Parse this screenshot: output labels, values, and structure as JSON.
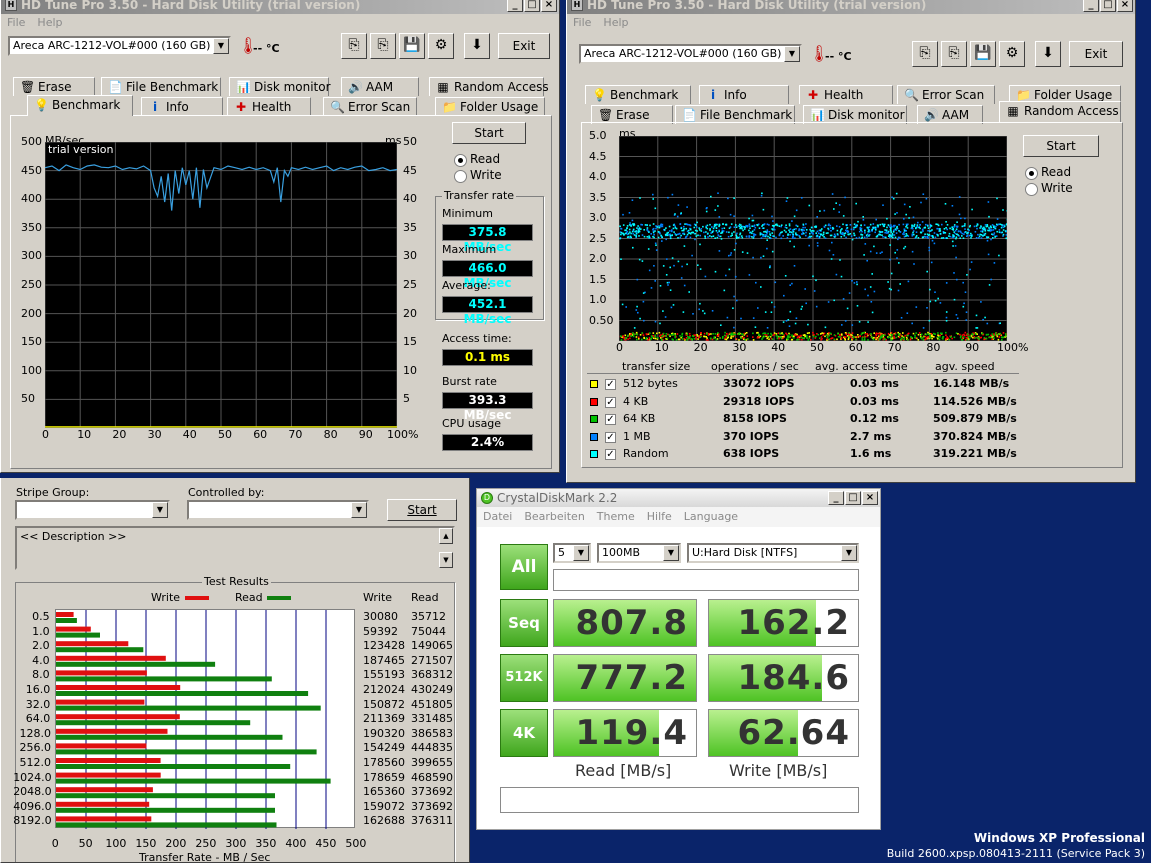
{
  "hdtune_left": {
    "title": "HD Tune Pro 3.50 - Hard Disk Utility (trial version)",
    "menu": [
      "File",
      "Help"
    ],
    "drive": "Areca  ARC-1212-VOL#000 (160 GB)",
    "temp": "-- °C",
    "exit_label": "Exit",
    "tabs_top": [
      "Erase",
      "File Benchmark",
      "Disk monitor",
      "AAM",
      "Random Access"
    ],
    "tabs_bottom": [
      "Benchmark",
      "Info",
      "Health",
      "Error Scan",
      "Folder Usage"
    ],
    "start_label": "Start",
    "read_label": "Read",
    "write_label": "Write",
    "chart_unit_left": "MB/sec",
    "chart_unit_right": "ms",
    "trial_label": "trial version",
    "transfer_rate_label": "Transfer rate",
    "minimum_label": "Minimum",
    "minimum": "375.8 MB/sec",
    "maximum_label": "Maximum",
    "maximum": "466.0 MB/sec",
    "average_label": "Average:",
    "average": "452.1 MB/sec",
    "access_time_label": "Access time:",
    "access_time": "0.1 ms",
    "burst_rate_label": "Burst rate",
    "burst_rate": "393.3 MB/sec",
    "cpu_usage_label": "CPU usage",
    "cpu_usage": "2.4%"
  },
  "hdtune_right": {
    "title": "HD Tune Pro 3.50 - Hard Disk Utility (trial version)",
    "menu": [
      "File",
      "Help"
    ],
    "drive": "Areca  ARC-1212-VOL#000 (160 GB)",
    "temp": "-- °C",
    "exit_label": "Exit",
    "tabs_top": [
      "Benchmark",
      "Info",
      "Health",
      "Error Scan",
      "Folder Usage"
    ],
    "tabs_bottom": [
      "Erase",
      "File Benchmark",
      "Disk monitor",
      "AAM",
      "Random Access"
    ],
    "start_label": "Start",
    "read_label": "Read",
    "write_label": "Write",
    "chart_unit": "ms",
    "table_headers": [
      "transfer size",
      "operations / sec",
      "avg. access time",
      "agv. speed"
    ],
    "rows": [
      {
        "size": "512 bytes",
        "ops": "33072 IOPS",
        "access": "0.03 ms",
        "speed": "16.148 MB/s",
        "color": "#ffff00"
      },
      {
        "size": "4 KB",
        "ops": "29318 IOPS",
        "access": "0.03 ms",
        "speed": "114.526 MB/s",
        "color": "#ff0000"
      },
      {
        "size": "64 KB",
        "ops": "8158 IOPS",
        "access": "0.12 ms",
        "speed": "509.879 MB/s",
        "color": "#00c000"
      },
      {
        "size": "1 MB",
        "ops": "370 IOPS",
        "access": "2.7 ms",
        "speed": "370.824 MB/s",
        "color": "#0080ff"
      },
      {
        "size": "Random",
        "ops": "638 IOPS",
        "access": "1.6 ms",
        "speed": "319.221 MB/s",
        "color": "#00ffff"
      }
    ]
  },
  "atto": {
    "stripe_group_label": "Stripe Group:",
    "controlled_by_label": "Controlled by:",
    "start_label": "Start",
    "description": "<< Description >>",
    "test_results_label": "Test Results",
    "write_legend": "Write",
    "read_legend": "Read",
    "col_write": "Write",
    "col_read": "Read",
    "xlabel": "Transfer Rate - MB / Sec"
  },
  "cdm": {
    "title": "CrystalDiskMark 2.2",
    "menu": [
      "Datei",
      "Bearbeiten",
      "Theme",
      "Hilfe",
      "Language"
    ],
    "all_label": "All",
    "count": "5",
    "size": "100MB",
    "drive": "U:Hard Disk [NTFS]",
    "seq_label": "Seq",
    "k512_label": "512K",
    "k4_label": "4K",
    "seq_read": "807.8",
    "seq_write": "162.2",
    "k512_read": "777.2",
    "k512_write": "184.6",
    "k4_read": "119.4",
    "k4_write": "62.64",
    "read_label": "Read [MB/s]",
    "write_label": "Write [MB/s]"
  },
  "os": {
    "name": "Windows XP Professional",
    "build": "Build 2600.xpsp.080413-2111 (Service Pack 3)"
  },
  "chart_data": [
    {
      "type": "line",
      "chart": "hdtune-benchmark",
      "yticks": [
        50,
        100,
        150,
        200,
        250,
        300,
        350,
        400,
        450,
        500
      ],
      "ylim": [
        0,
        500
      ],
      "y2ticks": [
        5,
        10,
        15,
        20,
        25,
        30,
        35,
        40,
        45,
        50
      ],
      "y2lim": [
        0,
        50
      ],
      "xticks": [
        "0",
        "10",
        "20",
        "30",
        "40",
        "50",
        "60",
        "70",
        "80",
        "90",
        "100%"
      ],
      "xlim": [
        0,
        100
      ],
      "series": [
        {
          "color": "#3aa0e0",
          "x": [
            0,
            2,
            4,
            6,
            8,
            10,
            12,
            14,
            16,
            18,
            20,
            22,
            24,
            26,
            28,
            30,
            31,
            32,
            33,
            34,
            35,
            36,
            37,
            38,
            39,
            40,
            41,
            42,
            43,
            44,
            45,
            46,
            48,
            50,
            52,
            54,
            56,
            58,
            60,
            62,
            64,
            65,
            66,
            67,
            68,
            69,
            70,
            72,
            74,
            76,
            78,
            80,
            82,
            84,
            86,
            88,
            90,
            92,
            94,
            96,
            98,
            100
          ],
          "y": [
            455,
            458,
            450,
            460,
            455,
            452,
            458,
            460,
            456,
            455,
            458,
            452,
            455,
            453,
            458,
            450,
            420,
            405,
            440,
            395,
            445,
            380,
            450,
            410,
            455,
            425,
            450,
            400,
            455,
            385,
            452,
            420,
            455,
            452,
            458,
            455,
            452,
            456,
            452,
            455,
            450,
            430,
            455,
            395,
            450,
            440,
            455,
            452,
            456,
            452,
            455,
            458,
            450,
            455,
            452,
            456,
            458,
            450,
            452,
            455,
            450,
            452
          ]
        },
        {
          "color": "#ffff00",
          "x": [
            0,
            100
          ],
          "y": [
            2,
            2
          ]
        }
      ]
    },
    {
      "type": "scatter",
      "chart": "hdtune-random-access",
      "yticks": [
        "0.50",
        "1.0",
        "1.5",
        "2.0",
        "2.5",
        "3.0",
        "3.5",
        "4.0",
        "4.5",
        "5.0"
      ],
      "ylim": [
        0,
        5
      ],
      "xticks": [
        "0",
        "10",
        "20",
        "30",
        "40",
        "50",
        "60",
        "70",
        "80",
        "90",
        "100%"
      ],
      "xlim": [
        0,
        100
      ],
      "series": [
        {
          "name": "512 bytes",
          "color": "#ffff00",
          "y": 0.03
        },
        {
          "name": "4 KB",
          "color": "#ff0000",
          "y": 0.03
        },
        {
          "name": "64 KB",
          "color": "#00c000",
          "y": 0.12
        },
        {
          "name": "1 MB",
          "color": "#0080ff",
          "y": 2.7
        },
        {
          "name": "Random",
          "color": "#00ffff",
          "y": 1.6
        }
      ]
    },
    {
      "type": "bar",
      "chart": "atto",
      "categories": [
        "0.5",
        "1.0",
        "2.0",
        "4.0",
        "8.0",
        "16.0",
        "32.0",
        "64.0",
        "128.0",
        "256.0",
        "512.0",
        "1024.0",
        "2048.0",
        "4096.0",
        "8192.0"
      ],
      "xticks": [
        "0",
        "50",
        "100",
        "150",
        "200",
        "250",
        "300",
        "350",
        "400",
        "450",
        "500"
      ],
      "xlim": [
        0,
        500
      ],
      "series": [
        {
          "name": "Write",
          "color": "#e01010",
          "values": [
            30080,
            59392,
            123428,
            187465,
            155193,
            212024,
            150872,
            211369,
            190320,
            154249,
            178560,
            178659,
            165360,
            159072,
            162688
          ]
        },
        {
          "name": "Read",
          "color": "#108010",
          "values": [
            35712,
            75044,
            149065,
            271507,
            368312,
            430249,
            451805,
            331485,
            386583,
            444835,
            399655,
            468590,
            373692,
            373692,
            376311
          ]
        }
      ]
    }
  ]
}
